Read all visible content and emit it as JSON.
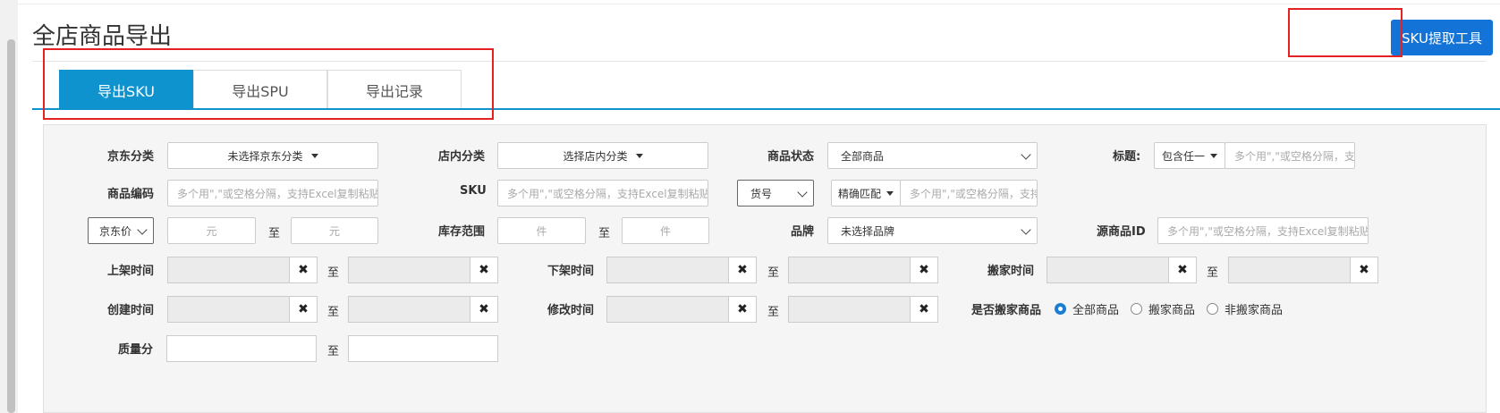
{
  "page": {
    "title": "全店商品导出",
    "sku_tool_button": "SKU提取工具"
  },
  "tabs": [
    {
      "label": "导出SKU",
      "active": true
    },
    {
      "label": "导出SPU",
      "active": false
    },
    {
      "label": "导出记录",
      "active": false
    }
  ],
  "filters": {
    "jd_category": {
      "label": "京东分类",
      "value": "未选择京东分类"
    },
    "shop_category": {
      "label": "店内分类",
      "value": "选择店内分类"
    },
    "product_status": {
      "label": "商品状态",
      "value": "全部商品"
    },
    "title": {
      "label": "标题:",
      "match": "包含任一",
      "placeholder": "多个用\",\"或空格分隔，支"
    },
    "product_code": {
      "label": "商品编码",
      "placeholder": "多个用\",\"或空格分隔，支持Excel复制粘贴"
    },
    "sku": {
      "label": "SKU",
      "placeholder": "多个用\",\"或空格分隔，支持Excel复制粘贴"
    },
    "item_no": {
      "select": "货号",
      "match": "精确匹配",
      "placeholder": "多个用\",\"或空格分隔，支持"
    },
    "price": {
      "select": "京东价",
      "from_placeholder": "元",
      "to": "至",
      "to_placeholder": "元"
    },
    "stock_range": {
      "label": "库存范围",
      "from_placeholder": "件",
      "to": "至",
      "to_placeholder": "件"
    },
    "brand": {
      "label": "品牌",
      "value": "未选择品牌"
    },
    "source_product_id": {
      "label": "源商品ID",
      "placeholder": "多个用\",\"或空格分隔，支持Excel复制粘贴"
    },
    "listed_time": {
      "label": "上架时间",
      "to": "至"
    },
    "delisted_time": {
      "label": "下架时间",
      "to": "至"
    },
    "moved_time": {
      "label": "搬家时间",
      "to": "至"
    },
    "created_time": {
      "label": "创建时间",
      "to": "至"
    },
    "modified_time": {
      "label": "修改时间",
      "to": "至"
    },
    "is_moved": {
      "label": "是否搬家商品",
      "options": [
        {
          "label": "全部商品",
          "checked": true
        },
        {
          "label": "搬家商品",
          "checked": false
        },
        {
          "label": "非搬家商品",
          "checked": false
        }
      ]
    },
    "quality_score": {
      "label": "质量分",
      "to": "至"
    }
  },
  "icons": {
    "clear": "close-icon"
  },
  "colors": {
    "primary": "#1473d6",
    "tab_active": "#0e93cf",
    "highlight": "#e52222"
  }
}
